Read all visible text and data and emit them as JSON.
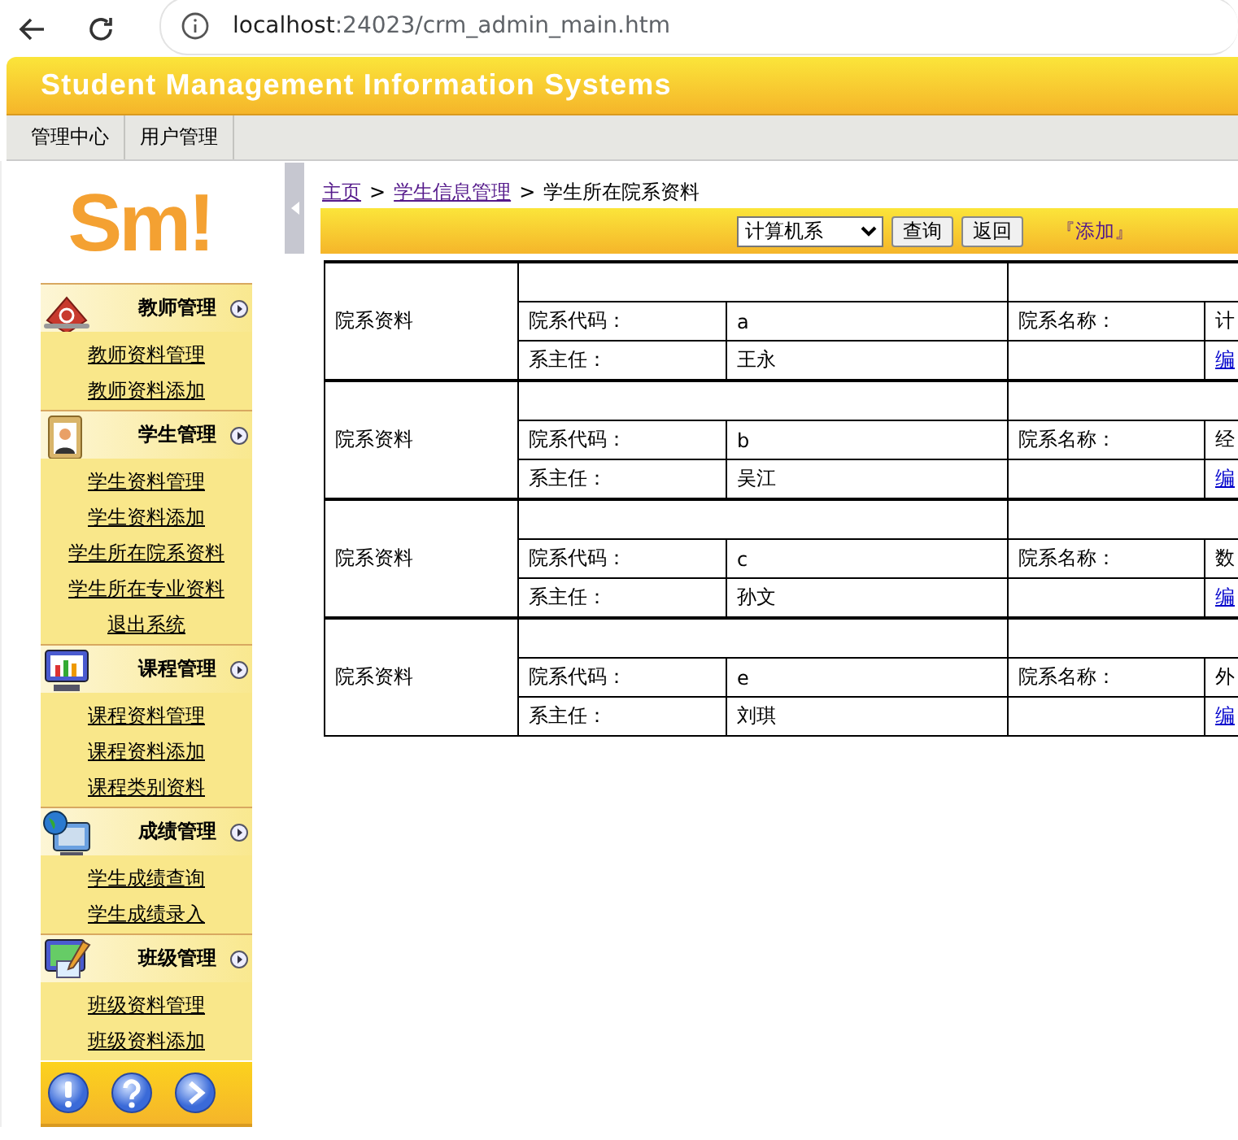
{
  "browser": {
    "url_host": "localhost",
    "url_path": ":24023/crm_admin_main.htm"
  },
  "header": {
    "title": "Student Management Information Systems"
  },
  "nav_tabs": [
    {
      "label": "管理中心"
    },
    {
      "label": "用户管理"
    }
  ],
  "sidebar": {
    "logo": "Sm!",
    "groups": [
      {
        "title": "教师管理",
        "items": [
          "教师资料管理",
          "教师资料添加"
        ]
      },
      {
        "title": "学生管理",
        "items": [
          "学生资料管理",
          "学生资料添加",
          "学生所在院系资料",
          "学生所在专业资料",
          "退出系统"
        ]
      },
      {
        "title": "课程管理",
        "items": [
          "课程资料管理",
          "课程资料添加",
          "课程类别资料"
        ]
      },
      {
        "title": "成绩管理",
        "items": [
          "学生成绩查询",
          "学生成绩录入"
        ]
      },
      {
        "title": "班级管理",
        "items": [
          "班级资料管理",
          "班级资料添加"
        ]
      }
    ]
  },
  "breadcrumb": [
    {
      "label": "主页",
      "link": true
    },
    {
      "label": ">",
      "link": false
    },
    {
      "label": "学生信息管理",
      "link": true
    },
    {
      "label": ">",
      "link": false
    },
    {
      "label": "学生所在院系资料",
      "link": false
    }
  ],
  "toolbar": {
    "department_select": "计算机系",
    "buttons": [
      "查询",
      "返回"
    ],
    "add_link": "『添加』"
  },
  "records": [
    {
      "label": "院系资料",
      "code_label": "院系代码：",
      "code": "a",
      "name_label": "院系名称：",
      "name": "计",
      "head_label": "系主任：",
      "head": "王永",
      "edit_link": "编"
    },
    {
      "label": "院系资料",
      "code_label": "院系代码：",
      "code": "b",
      "name_label": "院系名称：",
      "name": "经",
      "head_label": "系主任：",
      "head": "吴江",
      "edit_link": "编"
    },
    {
      "label": "院系资料",
      "code_label": "院系代码：",
      "code": "c",
      "name_label": "院系名称：",
      "name": "数",
      "head_label": "系主任：",
      "head": "孙文",
      "edit_link": "编"
    },
    {
      "label": "院系资料",
      "code_label": "院系代码：",
      "code": "e",
      "name_label": "院系名称：",
      "name": "外",
      "head_label": "系主任：",
      "head": "刘琪",
      "edit_link": "编"
    }
  ]
}
